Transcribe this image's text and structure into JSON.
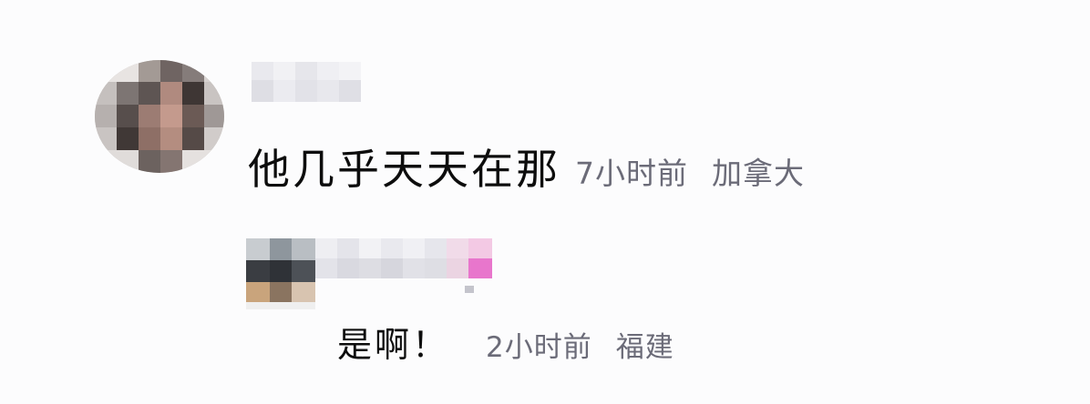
{
  "comments": [
    {
      "text": "他几乎天天在那",
      "time": "7小时前",
      "location": "加拿大",
      "avatar": "blurred-avatar",
      "username": ""
    }
  ],
  "replies": [
    {
      "text": "是啊！",
      "time": "2小时前",
      "location": "福建",
      "avatar": "blurred-avatar",
      "username": ""
    }
  ],
  "colors": {
    "text": "#0d0d0d",
    "meta": "#6b6b78",
    "background": "#fcfcfd"
  }
}
